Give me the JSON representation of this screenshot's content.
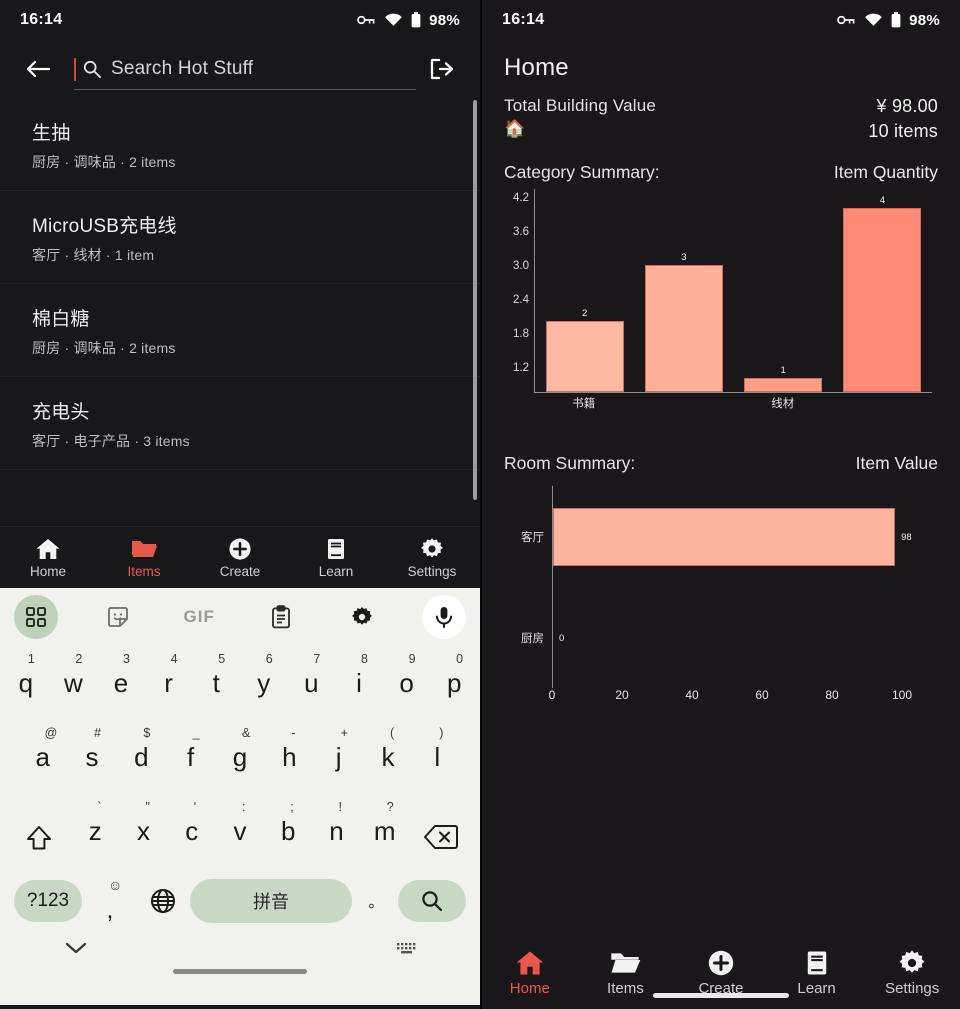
{
  "status_bar": {
    "time": "16:14",
    "battery": "98%",
    "icons": [
      "vpn-key-icon",
      "wifi-icon",
      "battery-icon"
    ]
  },
  "left_panel": {
    "search": {
      "placeholder": "Search Hot Stuff",
      "back_icon": "back-arrow-icon",
      "search_icon": "search-icon",
      "logout_icon": "logout-icon"
    },
    "items": [
      {
        "title": "生抽",
        "subtitle": "厨房 · 调味品 · 2 items"
      },
      {
        "title": "MicroUSB充电线",
        "subtitle": "客厅 · 线材 · 1 item"
      },
      {
        "title": "棉白糖",
        "subtitle": "厨房 · 调味品 · 2 items"
      },
      {
        "title": "充电头",
        "subtitle": "客厅 · 电子产品 · 3 items"
      }
    ],
    "nav": [
      {
        "label": "Home",
        "icon": "home-icon",
        "active": false
      },
      {
        "label": "Items",
        "icon": "folder-icon",
        "active": true
      },
      {
        "label": "Create",
        "icon": "plus-icon",
        "active": false
      },
      {
        "label": "Learn",
        "icon": "book-icon",
        "active": false
      },
      {
        "label": "Settings",
        "icon": "gear-icon",
        "active": false
      }
    ]
  },
  "keyboard": {
    "toolbar": [
      {
        "name": "apps-grid-icon",
        "label": ""
      },
      {
        "name": "sticker-icon",
        "label": ""
      },
      {
        "name": "gif-icon",
        "label": "GIF"
      },
      {
        "name": "clipboard-icon",
        "label": ""
      },
      {
        "name": "gear-icon",
        "label": ""
      },
      {
        "name": "microphone-icon",
        "label": ""
      }
    ],
    "row1": [
      {
        "main": "q",
        "alt": "1"
      },
      {
        "main": "w",
        "alt": "2"
      },
      {
        "main": "e",
        "alt": "3"
      },
      {
        "main": "r",
        "alt": "4"
      },
      {
        "main": "t",
        "alt": "5"
      },
      {
        "main": "y",
        "alt": "6"
      },
      {
        "main": "u",
        "alt": "7"
      },
      {
        "main": "i",
        "alt": "8"
      },
      {
        "main": "o",
        "alt": "9"
      },
      {
        "main": "p",
        "alt": "0"
      }
    ],
    "row2": [
      {
        "main": "a",
        "alt": "@"
      },
      {
        "main": "s",
        "alt": "#"
      },
      {
        "main": "d",
        "alt": "$"
      },
      {
        "main": "f",
        "alt": "_"
      },
      {
        "main": "g",
        "alt": "&"
      },
      {
        "main": "h",
        "alt": "-"
      },
      {
        "main": "j",
        "alt": "+"
      },
      {
        "main": "k",
        "alt": "("
      },
      {
        "main": "l",
        "alt": ")"
      }
    ],
    "row3": [
      {
        "main": "z",
        "alt": "`"
      },
      {
        "main": "x",
        "alt": "\""
      },
      {
        "main": "c",
        "alt": "'"
      },
      {
        "main": "v",
        "alt": ":"
      },
      {
        "main": "b",
        "alt": ";"
      },
      {
        "main": "n",
        "alt": "!"
      },
      {
        "main": "m",
        "alt": "?"
      }
    ],
    "shift_icon": "shift-icon",
    "backspace_icon": "backspace-icon",
    "row4": {
      "symbols_label": "?123",
      "comma_main": ",",
      "comma_alt": "☺",
      "globe_icon": "globe-icon",
      "space_label": "拼音",
      "period_label": "。",
      "search_icon": "search-icon"
    },
    "bottom": {
      "collapse_icon": "chevron-down-icon",
      "keyboard_icon": "keyboard-icon"
    }
  },
  "right_panel": {
    "title": "Home",
    "total_label": "Total Building Value",
    "total_emoji": "🏠",
    "total_amount": "¥ 98.00",
    "total_items": "10 items",
    "category_chart_title": "Category Summary:",
    "category_chart_metric": "Item Quantity",
    "room_chart_title": "Room Summary:",
    "room_chart_metric": "Item Value",
    "nav": [
      {
        "label": "Home",
        "icon": "home-icon",
        "active": true
      },
      {
        "label": "Items",
        "icon": "folder-icon",
        "active": false
      },
      {
        "label": "Create",
        "icon": "plus-icon",
        "active": false
      },
      {
        "label": "Learn",
        "icon": "book-icon",
        "active": false
      },
      {
        "label": "Settings",
        "icon": "gear-icon",
        "active": false
      }
    ]
  },
  "colors": {
    "accent": "#e8594b",
    "bar_light": "#fcb9a4",
    "bar_mid": "#fdae97",
    "bar_dark": "#ff8a75",
    "bar_border": "#d06a5c",
    "panel_bg": "#18181a",
    "keyboard_bg": "#f1f1ed",
    "key_accent": "#c9d7c6"
  },
  "chart_data": [
    {
      "type": "bar",
      "title": "Category Summary:",
      "subtitle": "Item Quantity",
      "orientation": "vertical",
      "categories": [
        "书籍",
        "",
        "线材",
        ""
      ],
      "values": [
        2,
        3,
        1,
        4
      ],
      "data_labels": [
        "2",
        "3",
        "1",
        "4"
      ],
      "yticks": [
        1.2,
        1.8,
        2.4,
        3.0,
        3.6,
        4.2
      ],
      "ylim": [
        0.75,
        4.35
      ],
      "xlabel": "",
      "ylabel": "",
      "grid": false,
      "legend": "none",
      "bar_colors": [
        "#fcb9a4",
        "#fdb09a",
        "#fd9e86",
        "#ff8a75"
      ]
    },
    {
      "type": "bar",
      "title": "Room Summary:",
      "subtitle": "Item Value",
      "orientation": "horizontal",
      "categories": [
        "客厅",
        "厨房"
      ],
      "values": [
        98,
        0
      ],
      "data_labels": [
        "98",
        "0"
      ],
      "xticks": [
        0,
        20,
        40,
        60,
        80,
        100
      ],
      "xlim": [
        0,
        108
      ],
      "xlabel": "",
      "ylabel": "",
      "grid": false,
      "legend": "none",
      "bar_colors": [
        "#fcb4a0",
        "#fcb4a0"
      ]
    }
  ]
}
